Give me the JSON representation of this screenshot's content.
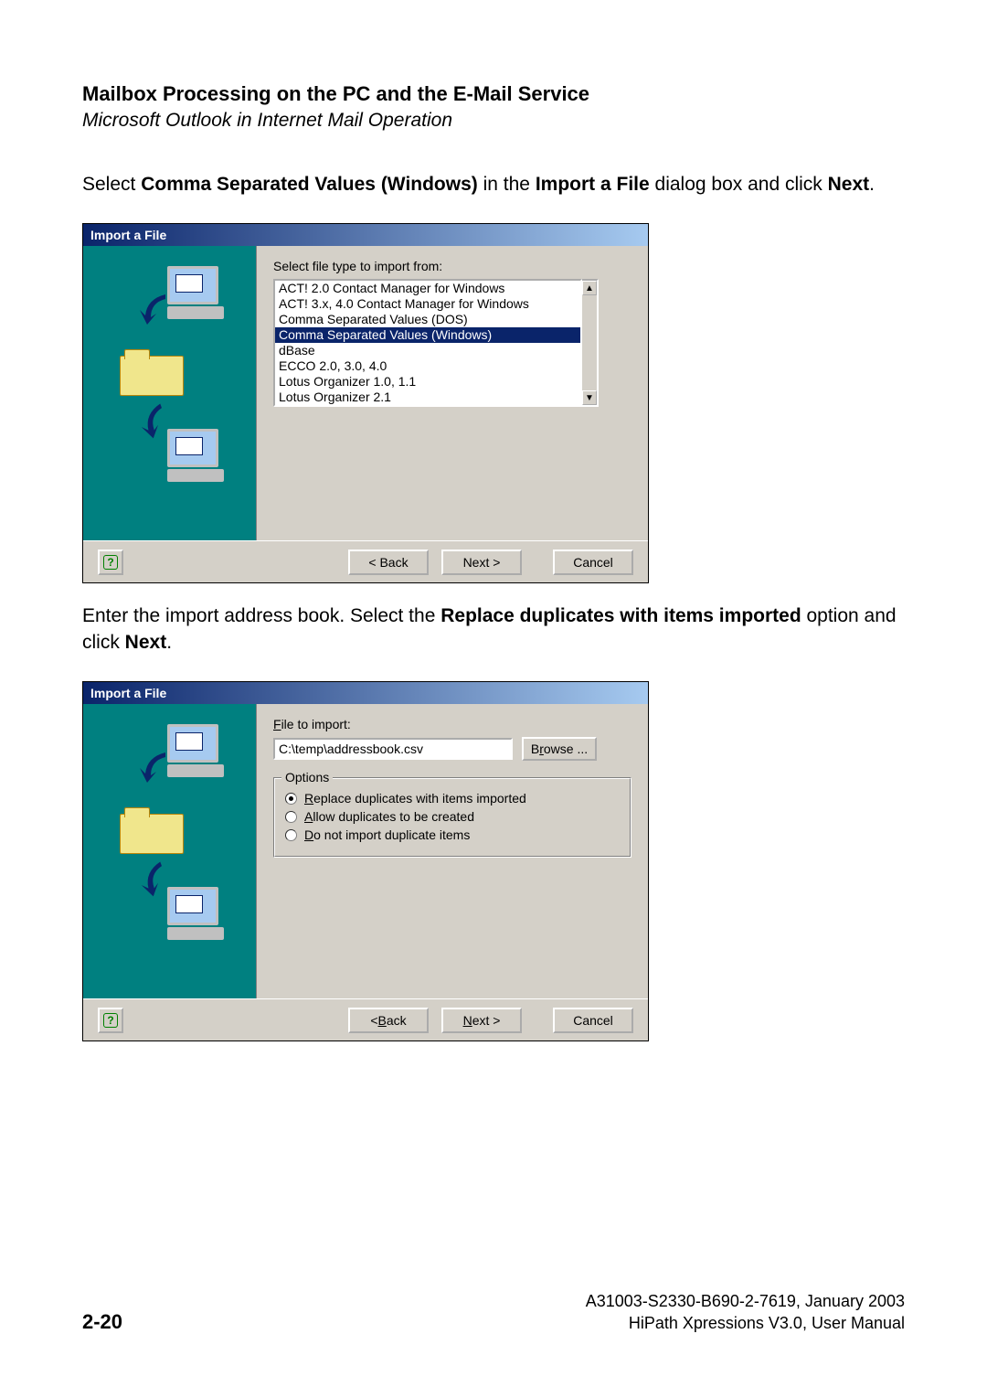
{
  "heading": "Mailbox Processing on the PC and the E-Mail Service",
  "subheading": "Microsoft Outlook in Internet Mail Operation",
  "para1": {
    "pre": "Select ",
    "b1": "Comma Separated Values (Windows)",
    "mid": " in the ",
    "b2": "Import a File",
    "post1": " dialog box and click ",
    "b3": "Next",
    "post2": "."
  },
  "para2": {
    "pre": "Enter the import address book. Select the ",
    "b1": "Replace duplicates with items imported",
    "mid": " option and click ",
    "b2": "Next",
    "post": "."
  },
  "dialog1": {
    "title": "Import a File",
    "prompt": "Select file type to import from:",
    "items": [
      "ACT! 2.0 Contact Manager for Windows",
      "ACT! 3.x, 4.0 Contact Manager for Windows",
      "Comma Separated Values (DOS)",
      "Comma Separated Values (Windows)",
      "dBase",
      "ECCO 2.0, 3.0, 4.0",
      "Lotus Organizer 1.0, 1.1",
      "Lotus Organizer 2.1"
    ],
    "selectedIndex": 3,
    "back": "< Back",
    "next": "Next >",
    "cancel": "Cancel"
  },
  "dialog2": {
    "title": "Import a File",
    "file_label_pre": "F",
    "file_label_post": "ile to import:",
    "file_value": "C:\\temp\\addressbook.csv",
    "browse_pre": "B",
    "browse_u": "r",
    "browse_post": "owse ...",
    "options_label": "Options",
    "radios": [
      {
        "pre": "",
        "u": "R",
        "post": "eplace duplicates with items imported",
        "checked": true
      },
      {
        "pre": "",
        "u": "A",
        "post": "llow duplicates to be created",
        "checked": false
      },
      {
        "pre": "",
        "u": "D",
        "post": "o not import duplicate items",
        "checked": false
      }
    ],
    "back_pre": "< ",
    "back_u": "B",
    "back_post": "ack",
    "next_u": "N",
    "next_post": "ext >",
    "cancel": "Cancel"
  },
  "footer": {
    "page": "2-20",
    "line1": "A31003-S2330-B690-2-7619, January 2003",
    "line2": "HiPath Xpressions V3.0, User Manual"
  },
  "glyphs": {
    "help": "?",
    "up": "▲",
    "down": "▼"
  }
}
